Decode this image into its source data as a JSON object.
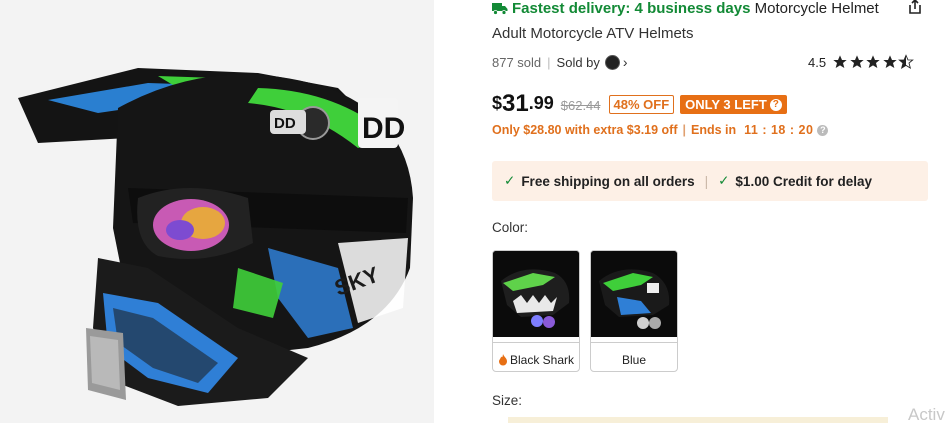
{
  "product": {
    "delivery_label": "Fastest delivery: 4 business days",
    "title_line1": "Motorcycle Helmet",
    "title_line2": "Adult Motorcycle ATV Helmets",
    "sold_count": "877 sold",
    "sold_by_label": "Sold by",
    "rating": "4.5",
    "rating_stars": 4.5
  },
  "price": {
    "currency": "$",
    "whole": "31",
    "cents": ".99",
    "original": "$62.44",
    "discount_badge": "48% OFF",
    "stock_badge": "ONLY 3 LEFT",
    "extra_offer": "Only $28.80 with extra $3.19 off",
    "ends_label": "Ends in",
    "countdown": "11 : 18 : 20"
  },
  "shipping": {
    "free_shipping": "Free shipping on all orders",
    "credit": "$1.00 Credit for delay"
  },
  "color": {
    "label": "Color:",
    "options": [
      {
        "name": "Black Shark"
      },
      {
        "name": "Blue"
      }
    ]
  },
  "size": {
    "label": "Size:"
  },
  "watermark": {
    "text": "Activ"
  },
  "colors": {
    "accent_orange": "#e76f14",
    "delivery_green": "#138a36",
    "banner_bg": "#fdf0e6"
  }
}
